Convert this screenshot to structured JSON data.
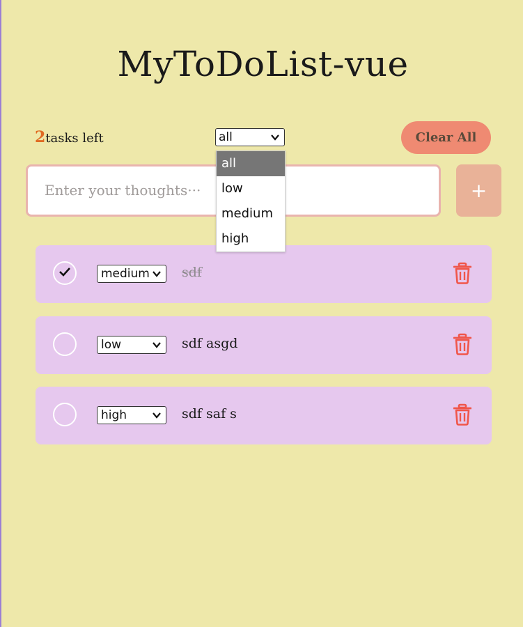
{
  "app": {
    "title": "MyToDoList-vue"
  },
  "summary": {
    "count": "2",
    "label": "tasks left"
  },
  "filter": {
    "selected": "all",
    "options": [
      "all",
      "low",
      "medium",
      "high"
    ],
    "highlighted": "all"
  },
  "actions": {
    "clear_label": "Clear All",
    "add_label": "+"
  },
  "input": {
    "placeholder": "Enter your thoughts···",
    "value": ""
  },
  "tasks": [
    {
      "priority": "medium",
      "text": "sdf",
      "completed": true
    },
    {
      "priority": "low",
      "text": "sdf asgd",
      "completed": false
    },
    {
      "priority": "high",
      "text": "sdf saf s",
      "completed": false
    }
  ],
  "colors": {
    "background": "#eee8aa",
    "task_card": "#e6c8ee",
    "accent_count": "#e06a22",
    "clear_button": "#ef8a72",
    "add_button": "#e9b298",
    "trash": "#f0564a",
    "input_border": "#e9b4ae"
  },
  "icons": {
    "check": "check-icon",
    "trash": "trash-icon",
    "chevron": "chevron-down-icon"
  }
}
